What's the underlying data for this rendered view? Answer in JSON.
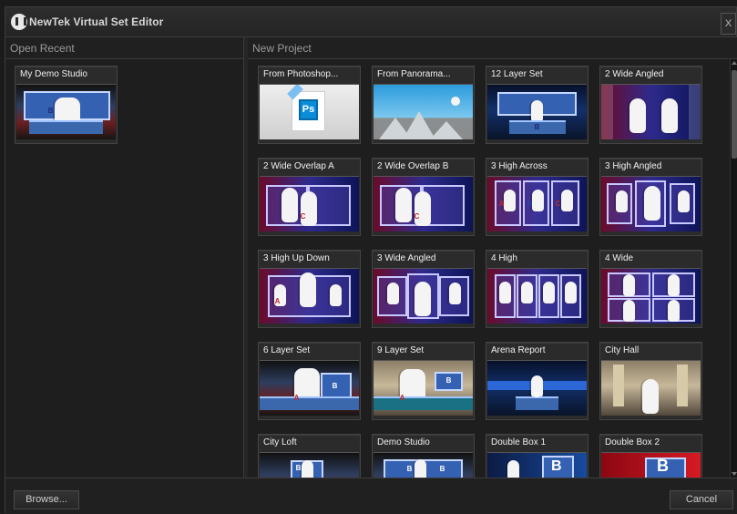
{
  "window": {
    "title": "NewTek Virtual Set Editor",
    "close_label": "X"
  },
  "sections": {
    "open_recent": "Open Recent",
    "new_project": "New Project"
  },
  "recent": [
    {
      "label": "My Demo Studio"
    }
  ],
  "projects": [
    {
      "label": "From Photoshop..."
    },
    {
      "label": "From Panorama..."
    },
    {
      "label": "12 Layer Set"
    },
    {
      "label": "2 Wide Angled"
    },
    {
      "label": "2 Wide Overlap A"
    },
    {
      "label": "2 Wide Overlap B"
    },
    {
      "label": "3 High Across"
    },
    {
      "label": "3 High Angled"
    },
    {
      "label": "3 High Up Down"
    },
    {
      "label": "3 Wide Angled"
    },
    {
      "label": "4 High"
    },
    {
      "label": "4 Wide"
    },
    {
      "label": "6 Layer Set"
    },
    {
      "label": "9 Layer Set"
    },
    {
      "label": "Arena Report"
    },
    {
      "label": "City Hall"
    },
    {
      "label": "City Loft"
    },
    {
      "label": "Demo Studio"
    },
    {
      "label": "Double Box 1"
    },
    {
      "label": "Double Box 2"
    }
  ],
  "footer": {
    "browse_label": "Browse...",
    "cancel_label": "Cancel"
  },
  "thumb_text": {
    "ps": "Ps",
    "letters": [
      "A",
      "B",
      "C"
    ]
  }
}
